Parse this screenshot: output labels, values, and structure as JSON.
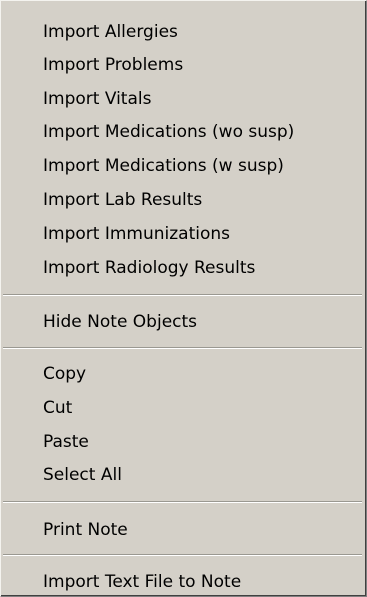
{
  "context_menu": {
    "import_group": [
      "Import Allergies",
      "Import Problems",
      "Import Vitals",
      "Import Medications (wo susp)",
      "Import Medications (w susp)",
      "Import Lab Results",
      "Import Immunizations",
      "Import Radiology Results"
    ],
    "hide_note_objects": "Hide Note Objects",
    "edit_group": [
      "Copy",
      "Cut",
      "Paste",
      "Select All"
    ],
    "print_note": "Print Note",
    "import_text_file": "Import Text File to Note"
  }
}
